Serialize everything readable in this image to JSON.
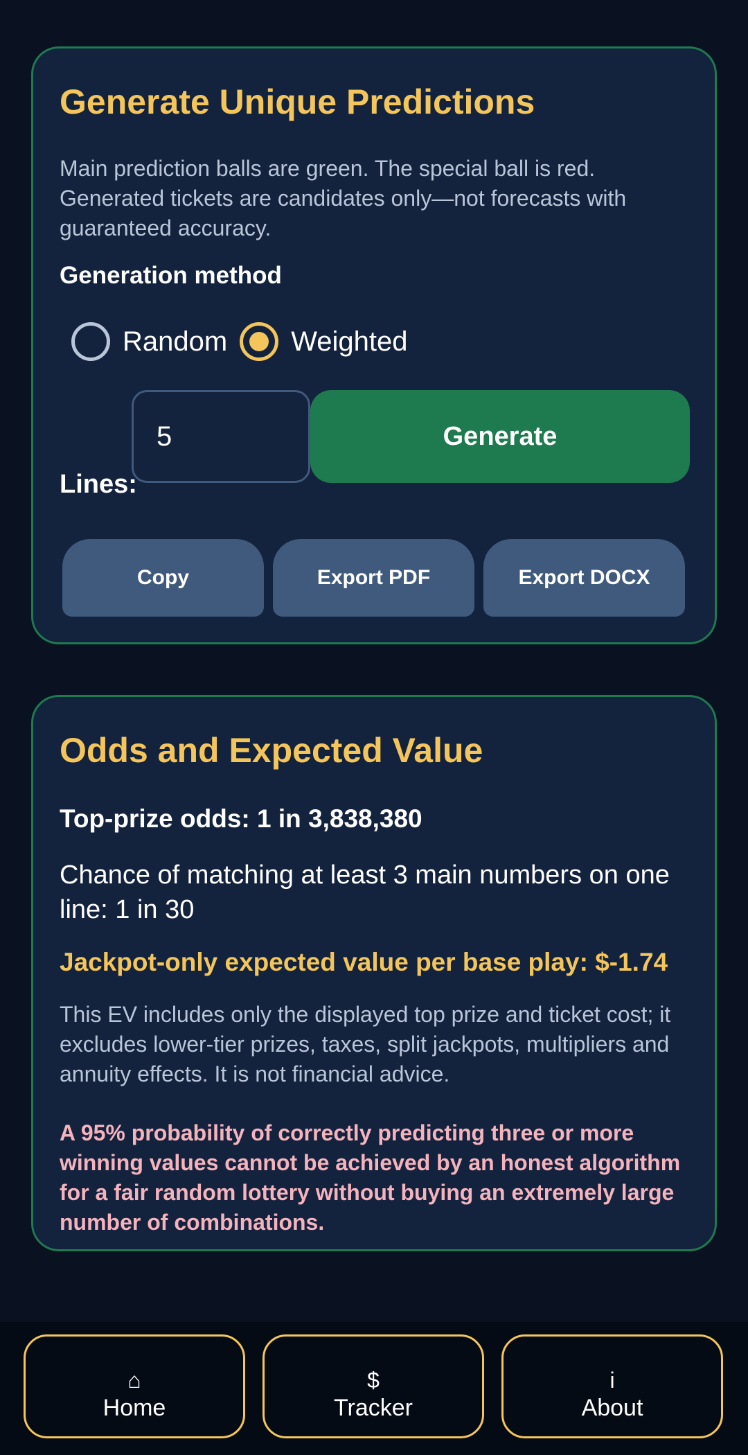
{
  "generate_card": {
    "title": "Generate Unique Predictions",
    "description": "Main prediction balls are green. The special ball is red. Generated tickets are candidates only—not forecasts with guaranteed accuracy.",
    "method_label": "Generation method",
    "methods": [
      {
        "label": "Random",
        "selected": false
      },
      {
        "label": "Weighted",
        "selected": true
      }
    ],
    "lines_label": "Lines:",
    "lines_value": "5",
    "generate_label": "Generate",
    "copy_label": "Copy",
    "export_pdf_label": "Export PDF",
    "export_docx_label": "Export DOCX"
  },
  "odds_card": {
    "title": "Odds and Expected Value",
    "top_prize": "Top-prize odds: 1 in 3,838,380",
    "chance": "Chance of matching at least 3 main numbers on one line: 1 in 30",
    "ev": "Jackpot-only expected value per base play: $-1.74",
    "disclaimer": "This EV includes only the displayed top prize and ticket cost; it excludes lower-tier prizes, taxes, split jackpots, multipliers and annuity effects. It is not financial advice.",
    "warning": "A 95% probability of correctly predicting three or more winning values cannot be achieved by an honest algorithm for a fair random lottery without buying an extremely large number of combinations."
  },
  "nav": {
    "items": [
      {
        "icon": "⌂",
        "icon_name": "home-icon",
        "label": "Home"
      },
      {
        "icon": "$",
        "icon_name": "dollar-icon",
        "label": "Tracker"
      },
      {
        "icon": "i",
        "icon_name": "info-icon",
        "label": "About"
      }
    ]
  },
  "colors": {
    "accent_yellow": "#f4c55a",
    "green": "#1e7a4f",
    "card_bg": "#13223d",
    "page_bg": "#0a1120",
    "warning_pink": "#f5b4bd"
  }
}
